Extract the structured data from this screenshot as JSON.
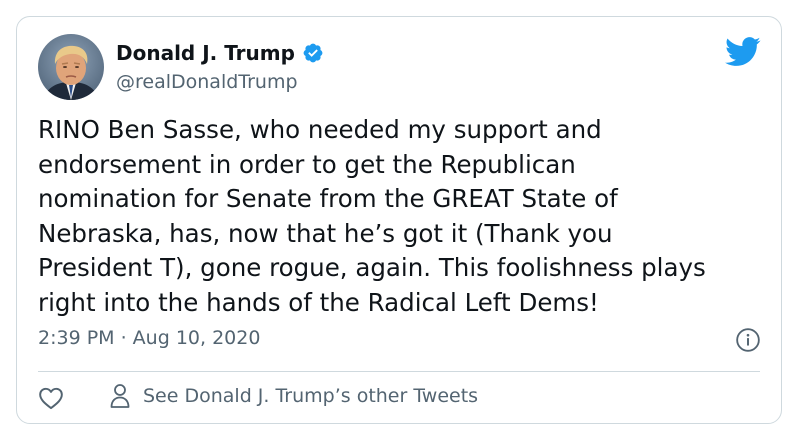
{
  "author": {
    "display_name": "Donald J. Trump",
    "handle": "@realDonaldTrump",
    "verified": true,
    "avatar": "avatar-photo"
  },
  "tweet": {
    "lines": [
      "RINO Ben Sasse, who needed my support and",
      "endorsement in order to get the Republican",
      "nomination for Senate from the GREAT State of",
      "Nebraska, has, now that he’s got it (Thank you",
      "President T), gone rogue, again. This foolishness plays",
      "right into the hands of the Radical Left Dems!"
    ],
    "timestamp": "2:39 PM · Aug 10, 2020"
  },
  "actions": {
    "other_tweets_label": "See Donald J. Trump’s other Tweets"
  },
  "icons": {
    "brand": "twitter-bird-icon",
    "verified": "verified-badge-icon",
    "info": "info-icon",
    "like": "heart-icon",
    "profile": "person-icon"
  },
  "colors": {
    "twitter_blue": "#1d9bf0",
    "text_primary": "#0f1419",
    "text_secondary": "#536471",
    "border": "#cfd9de"
  }
}
